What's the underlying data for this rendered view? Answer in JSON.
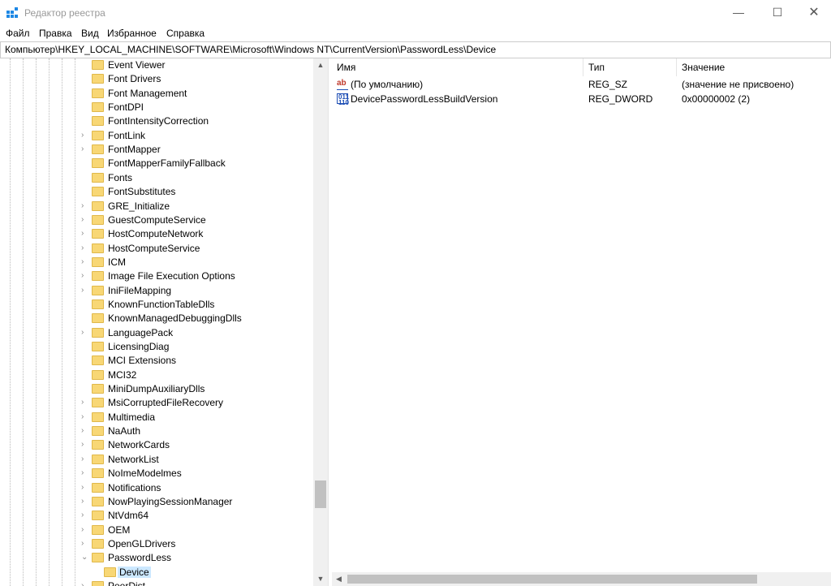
{
  "window": {
    "title": "Редактор реестра",
    "minimize": "—",
    "maximize": "☐",
    "close": "✕"
  },
  "menu": [
    "Файл",
    "Правка",
    "Вид",
    "Избранное",
    "Справка"
  ],
  "address": "Компьютер\\HKEY_LOCAL_MACHINE\\SOFTWARE\\Microsoft\\Windows NT\\CurrentVersion\\PasswordLess\\Device",
  "tree": [
    {
      "label": "Event Viewer",
      "exp": ""
    },
    {
      "label": "Font Drivers",
      "exp": ""
    },
    {
      "label": "Font Management",
      "exp": ""
    },
    {
      "label": "FontDPI",
      "exp": ""
    },
    {
      "label": "FontIntensityCorrection",
      "exp": ""
    },
    {
      "label": "FontLink",
      "exp": "›"
    },
    {
      "label": "FontMapper",
      "exp": "›"
    },
    {
      "label": "FontMapperFamilyFallback",
      "exp": ""
    },
    {
      "label": "Fonts",
      "exp": ""
    },
    {
      "label": "FontSubstitutes",
      "exp": ""
    },
    {
      "label": "GRE_Initialize",
      "exp": "›"
    },
    {
      "label": "GuestComputeService",
      "exp": "›"
    },
    {
      "label": "HostComputeNetwork",
      "exp": "›"
    },
    {
      "label": "HostComputeService",
      "exp": "›"
    },
    {
      "label": "ICM",
      "exp": "›"
    },
    {
      "label": "Image File Execution Options",
      "exp": "›"
    },
    {
      "label": "IniFileMapping",
      "exp": "›"
    },
    {
      "label": "KnownFunctionTableDlls",
      "exp": ""
    },
    {
      "label": "KnownManagedDebuggingDlls",
      "exp": ""
    },
    {
      "label": "LanguagePack",
      "exp": "›"
    },
    {
      "label": "LicensingDiag",
      "exp": ""
    },
    {
      "label": "MCI Extensions",
      "exp": ""
    },
    {
      "label": "MCI32",
      "exp": ""
    },
    {
      "label": "MiniDumpAuxiliaryDlls",
      "exp": ""
    },
    {
      "label": "MsiCorruptedFileRecovery",
      "exp": "›"
    },
    {
      "label": "Multimedia",
      "exp": "›"
    },
    {
      "label": "NaAuth",
      "exp": "›"
    },
    {
      "label": "NetworkCards",
      "exp": "›"
    },
    {
      "label": "NetworkList",
      "exp": "›"
    },
    {
      "label": "NoImeModelmes",
      "exp": "›"
    },
    {
      "label": "Notifications",
      "exp": "›"
    },
    {
      "label": "NowPlayingSessionManager",
      "exp": "›"
    },
    {
      "label": "NtVdm64",
      "exp": "›"
    },
    {
      "label": "OEM",
      "exp": "›"
    },
    {
      "label": "OpenGLDrivers",
      "exp": "›"
    },
    {
      "label": "PasswordLess",
      "exp": "⌄"
    },
    {
      "label": "Device",
      "exp": "",
      "child": true,
      "selected": true
    },
    {
      "label": "PeerDist",
      "exp": "›"
    }
  ],
  "columns": {
    "name": "Имя",
    "type": "Тип",
    "value": "Значение"
  },
  "values": [
    {
      "icon": "ab",
      "name": "(По умолчанию)",
      "type": "REG_SZ",
      "value": "(значение не присвоено)"
    },
    {
      "icon": "011\n110",
      "name": "DevicePasswordLessBuildVersion",
      "type": "REG_DWORD",
      "value": "0x00000002 (2)"
    }
  ],
  "colors": {
    "folder": "#f8d775",
    "selection": "#cce8ff",
    "icon_red": "#c0392b",
    "icon_blue": "#1f4fb5"
  }
}
